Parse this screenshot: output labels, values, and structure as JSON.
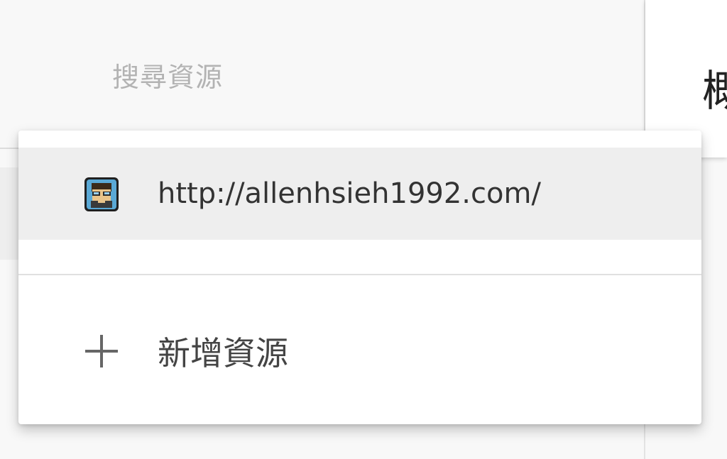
{
  "search": {
    "placeholder": "搜尋資源"
  },
  "right_panel": {
    "heading": "概"
  },
  "dropdown": {
    "properties": [
      {
        "url": "http://allenhsieh1992.com/",
        "favicon": "site-avatar-icon"
      }
    ],
    "add_property_label": "新增資源",
    "add_icon": "plus-icon"
  },
  "colors": {
    "placeholder": "#b3b3b3",
    "selected_bg": "#eeeeee",
    "icon": "#666666"
  }
}
